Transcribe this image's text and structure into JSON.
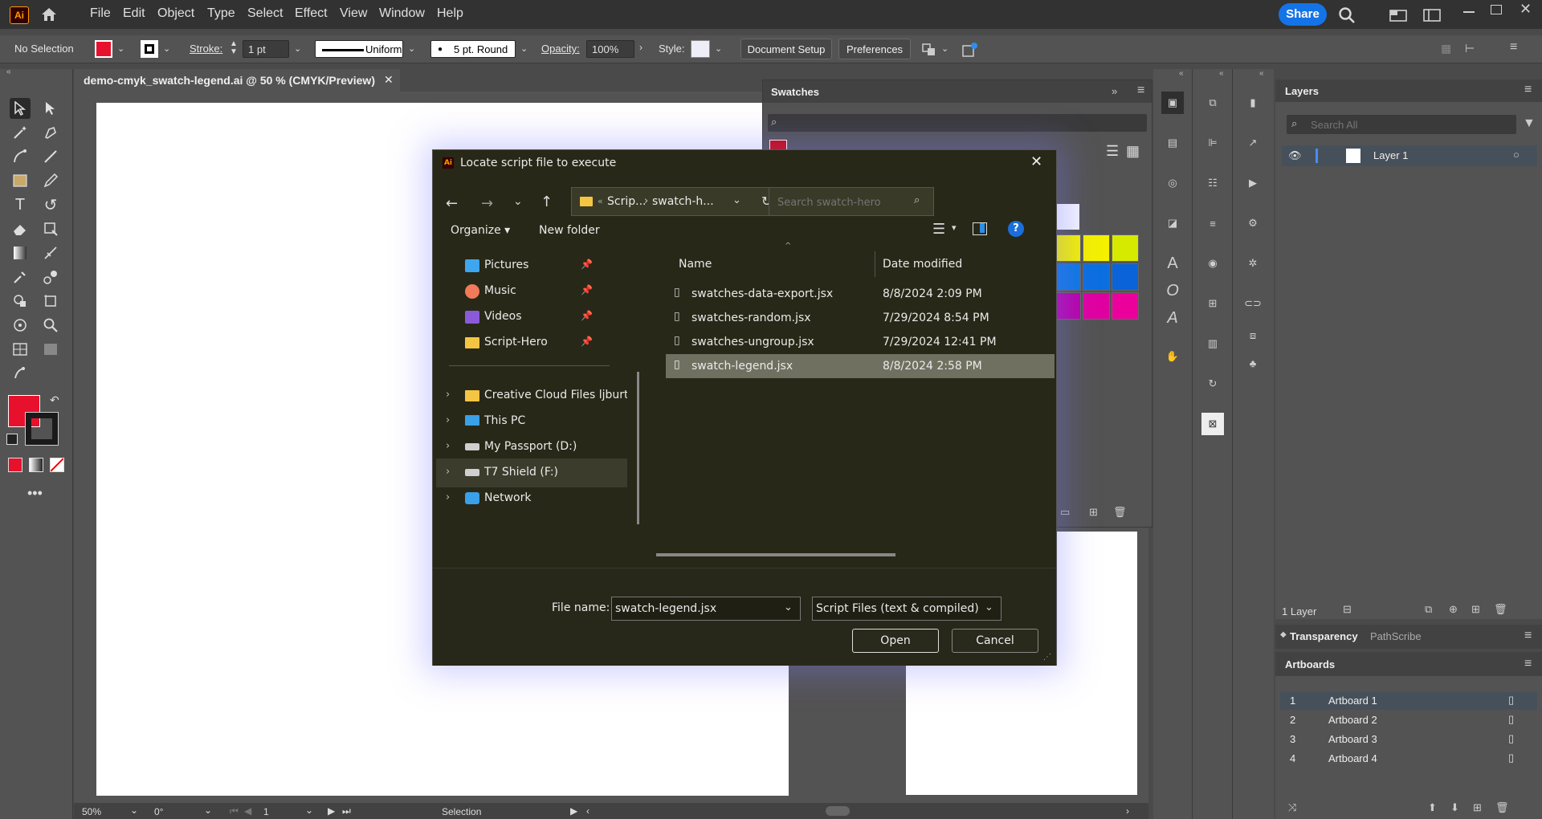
{
  "menubar": {
    "app_logo": "Ai",
    "items": [
      "File",
      "Edit",
      "Object",
      "Type",
      "Select",
      "Effect",
      "View",
      "Window",
      "Help"
    ],
    "share_label": "Share"
  },
  "controlbar": {
    "selection_status": "No Selection",
    "stroke_label": "Stroke:",
    "stroke_value": "1 pt",
    "stroke_profile": "Uniform",
    "brush_label": "5 pt. Round",
    "opacity_label": "Opacity:",
    "opacity_value": "100%",
    "style_label": "Style:",
    "document_setup_label": "Document Setup",
    "preferences_label": "Preferences",
    "fill_color": "#e8112d"
  },
  "document": {
    "tab_title": "demo-cmyk_swatch-legend.ai @ 50 % (CMYK/Preview)",
    "zoom": "50%",
    "rotation": "0°",
    "artboard_number": "1",
    "status_tool": "Selection"
  },
  "swatches_panel": {
    "title": "Swatches",
    "swatch_colors": [
      "#f4f000",
      "#f4f000",
      "#d6ea00",
      "#0c77e0",
      "#0c6fe0",
      "#0a63d8",
      "#b800a8",
      "#e000a0",
      "#ec009c"
    ]
  },
  "layers_panel": {
    "title": "Layers",
    "search_placeholder": "Search All",
    "layer_name": "Layer 1",
    "layer_count": "1 Layer"
  },
  "lower_panels": {
    "tab_transparency": "Transparency",
    "tab_pathscribe": "PathScribe",
    "artboards_title": "Artboards",
    "artboards": [
      {
        "num": "1",
        "name": "Artboard 1"
      },
      {
        "num": "2",
        "name": "Artboard 2"
      },
      {
        "num": "3",
        "name": "Artboard 3"
      },
      {
        "num": "4",
        "name": "Artboard 4"
      }
    ]
  },
  "dialog": {
    "title": "Locate script file to execute",
    "breadcrumb_1": "Scrip...",
    "breadcrumb_2": "swatch-h...",
    "search_placeholder": "Search swatch-hero",
    "organize_label": "Organize",
    "new_folder_label": "New folder",
    "nav_items": [
      {
        "label": "Pictures",
        "icon": "pictures-icon",
        "pinned": true
      },
      {
        "label": "Music",
        "icon": "music-icon",
        "pinned": true
      },
      {
        "label": "Videos",
        "icon": "videos-icon",
        "pinned": true
      },
      {
        "label": "Script-Hero",
        "icon": "folder-icon",
        "pinned": true
      },
      {
        "label": "Creative Cloud Files  ljburt",
        "icon": "folder-icon",
        "pinned": false
      },
      {
        "label": "This PC",
        "icon": "computer-icon",
        "pinned": false
      },
      {
        "label": "My Passport (D:)",
        "icon": "drive-icon",
        "pinned": false
      },
      {
        "label": "T7 Shield (F:)",
        "icon": "drive-icon",
        "pinned": false
      },
      {
        "label": "Network",
        "icon": "network-icon",
        "pinned": false
      }
    ],
    "columns": {
      "name": "Name",
      "date": "Date modified"
    },
    "files": [
      {
        "name": "swatches-data-export.jsx",
        "date": "8/8/2024 2:09 PM"
      },
      {
        "name": "swatches-random.jsx",
        "date": "7/29/2024 8:54 PM"
      },
      {
        "name": "swatches-ungroup.jsx",
        "date": "7/29/2024 12:41 PM"
      },
      {
        "name": "swatch-legend.jsx",
        "date": "8/8/2024 2:58 PM"
      }
    ],
    "file_name_label": "File name:",
    "file_name_value": "swatch-legend.jsx",
    "file_type_value": "Script Files (text & compiled) (*",
    "open_label": "Open",
    "cancel_label": "Cancel"
  }
}
